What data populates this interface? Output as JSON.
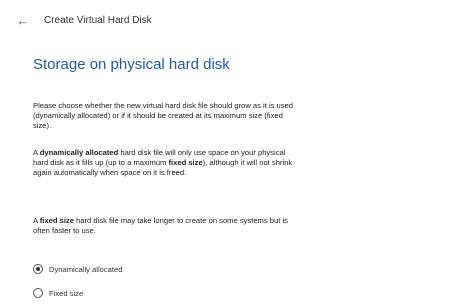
{
  "header": {
    "back_icon": "back-arrow-icon",
    "title": "Create Virtual Hard Disk"
  },
  "main": {
    "heading": "Storage on physical hard disk",
    "p1": {
      "l1": "Please choose whether the new virtual hard disk file should grow as it is used",
      "l2": "(dynamically allocated) or if it should be created at its maximum size (fixed",
      "l3": "size)."
    },
    "p2": {
      "l1_a": "A ",
      "l1_b": "dynamically allocated",
      "l1_c": " hard disk file will only use space on your physical",
      "l2_a": "hard disk as it fills up (up to a maximum ",
      "l2_b": "fixed size",
      "l2_c": "), although it will not shrink",
      "l3": "again automatically when space on it is freed."
    },
    "p3": {
      "l1_a": "A ",
      "l1_b": "fixed size",
      "l1_c": " hard disk file may take longer to create on some systems but is",
      "l2": "often faster to use."
    },
    "options": [
      {
        "label": "Dynamically allocated",
        "selected": true
      },
      {
        "label": "Fixed size",
        "selected": false
      }
    ]
  }
}
